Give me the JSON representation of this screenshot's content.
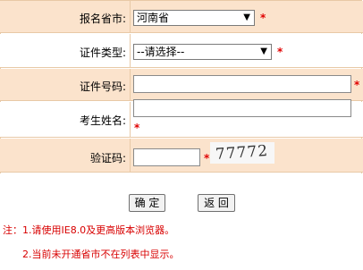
{
  "form": {
    "province": {
      "label": "报名省市:",
      "value": "河南省"
    },
    "id_type": {
      "label": "证件类型:",
      "value": "--请选择--"
    },
    "id_number": {
      "label": "证件号码:",
      "value": ""
    },
    "name": {
      "label": "考生姓名:",
      "value": ""
    },
    "captcha": {
      "label": "验证码:",
      "value": "",
      "image_text": "77772"
    },
    "required_mark": "*"
  },
  "buttons": {
    "confirm": "确 定",
    "back": "返 回"
  },
  "notes": {
    "line1": "注：1.请使用IE8.0及更高版本浏览器。",
    "line2": "2.当前未开通省市不在列表中显示。"
  },
  "colors": {
    "row_shaded": "#fbe3cc",
    "row_white": "#ffffff",
    "border": "#e8c9a6",
    "required": "#e00000",
    "note": "#d80000"
  }
}
